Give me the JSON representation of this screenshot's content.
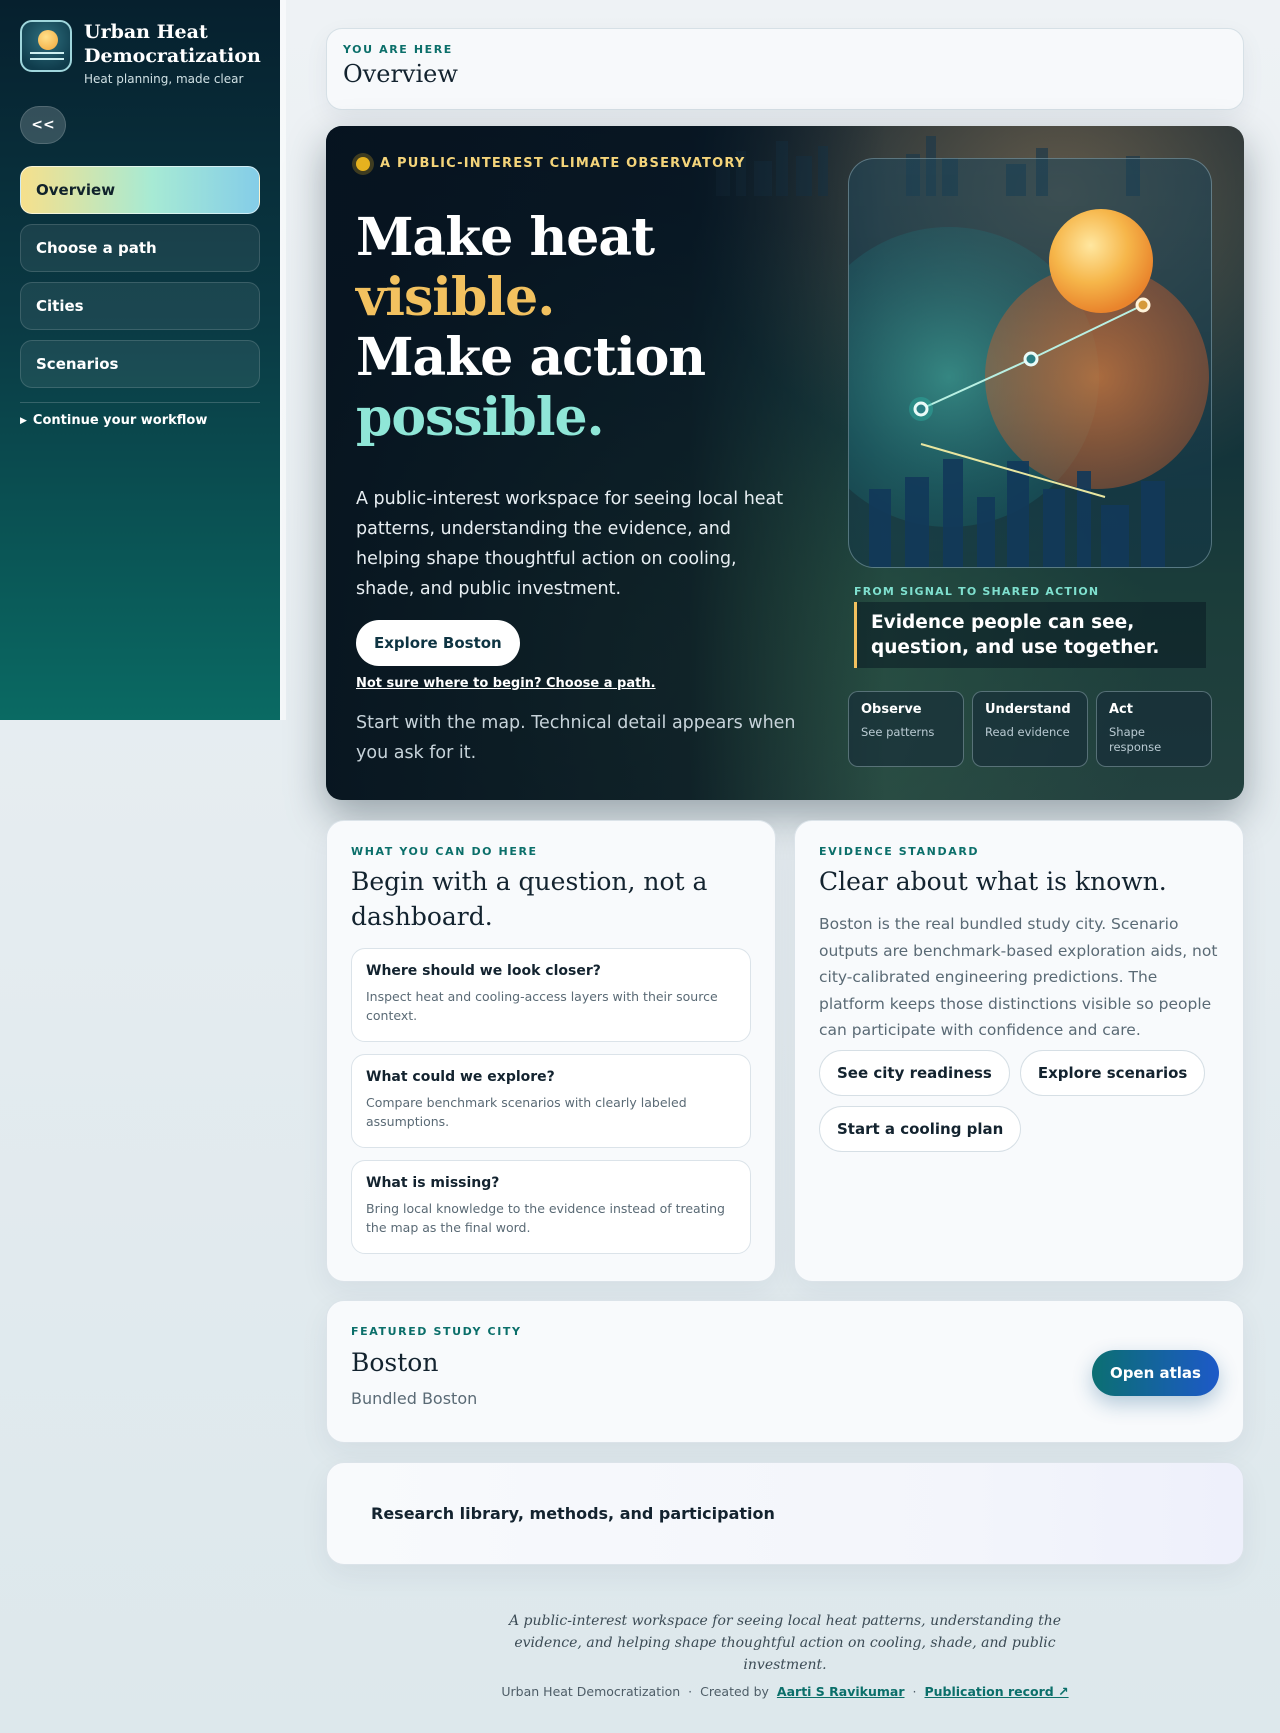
{
  "brand": {
    "title": "Urban Heat Democratization",
    "subtitle": "Heat planning, made clear"
  },
  "sidebar": {
    "collapse_label": "<<",
    "items": [
      {
        "label": "Overview",
        "active": true
      },
      {
        "label": "Choose a path"
      },
      {
        "label": "Cities"
      },
      {
        "label": "Scenarios"
      }
    ],
    "workflow_label": "Continue your workflow"
  },
  "breadcrumb": {
    "eyebrow": "YOU ARE HERE",
    "title": "Overview"
  },
  "hero": {
    "eyebrow": "A PUBLIC-INTEREST CLIMATE OBSERVATORY",
    "headline": [
      "Make heat",
      "visible.",
      "Make action",
      "possible."
    ],
    "description": "A public-interest workspace for seeing local heat patterns, understanding the evidence, and helping shape thoughtful action on cooling, shade, and public investment.",
    "cta_label": "Explore Boston",
    "path_link": "Not sure where to begin? Choose a path.",
    "note": "Start with the map. Technical detail appears when you ask for it.",
    "signal_eyebrow": "FROM SIGNAL TO SHARED ACTION",
    "signal_quote": "Evidence people can see, question, and use together.",
    "steps": [
      {
        "title": "Observe",
        "sub": "See patterns"
      },
      {
        "title": "Understand",
        "sub": "Read evidence"
      },
      {
        "title": "Act",
        "sub": "Shape response"
      }
    ],
    "colors": {
      "gold": "#f2c15f",
      "mint": "#8fe6d7",
      "teal": "#2fbfae"
    }
  },
  "questions_card": {
    "eyebrow": "WHAT YOU CAN DO HERE",
    "title": "Begin with a question, not a dashboard.",
    "items": [
      {
        "title": "Where should we look closer?",
        "desc": "Inspect heat and cooling-access layers with their source context."
      },
      {
        "title": "What could we explore?",
        "desc": "Compare benchmark scenarios with clearly labeled assumptions."
      },
      {
        "title": "What is missing?",
        "desc": "Bring local knowledge to the evidence instead of treating the map as the final word."
      }
    ]
  },
  "evidence_card": {
    "eyebrow": "EVIDENCE STANDARD",
    "title": "Clear about what is known.",
    "text": "Boston is the real bundled study city. Scenario outputs are benchmark-based exploration aids, not city-calibrated engineering predictions. The platform keeps those distinctions visible so people can participate with confidence and care.",
    "chips": [
      "See city readiness",
      "Explore scenarios",
      "Start a cooling plan"
    ]
  },
  "featured": {
    "eyebrow": "FEATURED STUDY CITY",
    "title": "Boston",
    "subtitle": "Bundled Boston",
    "button": "Open atlas"
  },
  "research": {
    "label": "Research library, methods, and participation"
  },
  "footer": {
    "tagline": "A public-interest workspace for seeing local heat patterns, understanding the evidence, and helping shape thoughtful action on cooling, shade, and public investment.",
    "app_name": "Urban Heat Democratization",
    "sep": "·",
    "created_by": "Created by",
    "author": "Aarti S Ravikumar",
    "publication": "Publication record ↗"
  }
}
